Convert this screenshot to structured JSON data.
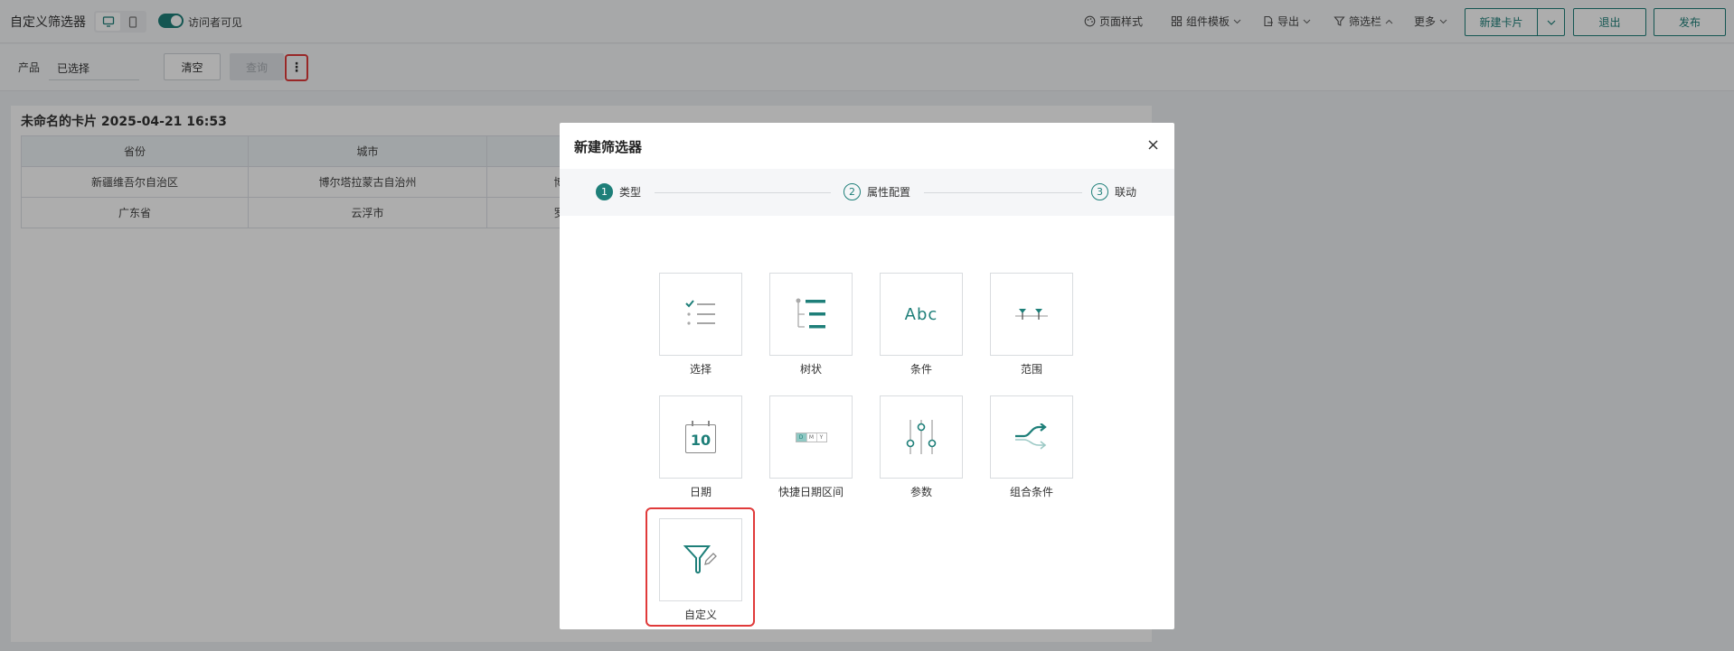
{
  "toolbar": {
    "title": "自定义筛选器",
    "visitor_visible_label": "访问者可见",
    "page_style": "页面样式",
    "component_template": "组件模板",
    "export": "导出",
    "filter_bar": "筛选栏",
    "more": "更多",
    "new_card": "新建卡片",
    "exit": "退出",
    "publish": "发布"
  },
  "filterbar": {
    "product_label": "产品",
    "product_value": "已选择",
    "clear": "清空",
    "query": "查询",
    "more_icon": "⋮"
  },
  "card": {
    "title": "未命名的卡片 2025-04-21 16:53",
    "columns": [
      "省份",
      "城市",
      ""
    ],
    "rows": [
      [
        "新疆维吾尔自治区",
        "博尔塔拉蒙古自治州",
        "博"
      ],
      [
        "广东省",
        "云浮市",
        "罗"
      ]
    ]
  },
  "modal": {
    "title": "新建筛选器",
    "steps": [
      {
        "num": "1",
        "label": "类型"
      },
      {
        "num": "2",
        "label": "属性配置"
      },
      {
        "num": "3",
        "label": "联动"
      }
    ],
    "tiles": [
      {
        "label": "选择",
        "icon": "select-list-icon"
      },
      {
        "label": "树状",
        "icon": "tree-icon"
      },
      {
        "label": "条件",
        "icon": "condition-text-icon"
      },
      {
        "label": "范围",
        "icon": "range-slider-icon"
      },
      {
        "label": "日期",
        "icon": "calendar-icon"
      },
      {
        "label": "快捷日期区间",
        "icon": "quick-date-icon"
      },
      {
        "label": "参数",
        "icon": "parameter-sliders-icon"
      },
      {
        "label": "组合条件",
        "icon": "combo-arrow-icon"
      },
      {
        "label": "自定义",
        "icon": "custom-funnel-icon"
      }
    ],
    "calendar_day": "10",
    "condition_text": "Abc",
    "quick_date_letters": [
      "D",
      "M",
      "Y"
    ]
  },
  "colors": {
    "accent": "#1e7f79",
    "highlight": "#e03a3a"
  }
}
